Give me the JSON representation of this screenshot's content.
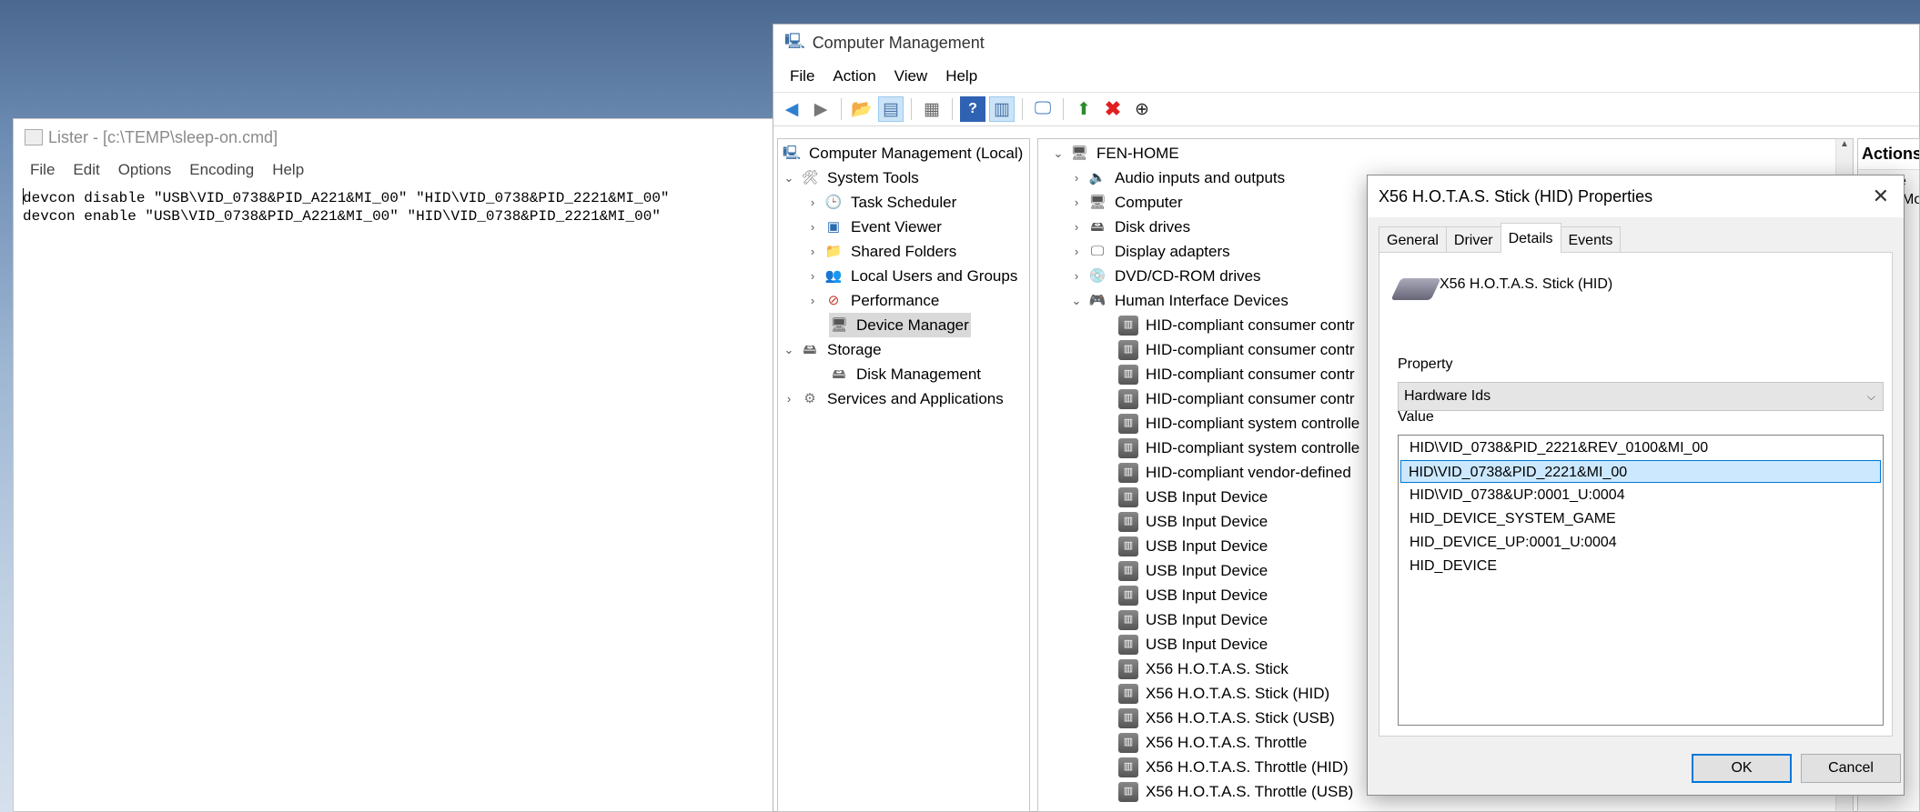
{
  "lister": {
    "title": "Lister - [c:\\TEMP\\sleep-on.cmd]",
    "menu": [
      "File",
      "Edit",
      "Options",
      "Encoding",
      "Help"
    ],
    "lines": [
      "devcon disable \"USB\\VID_0738&PID_A221&MI_00\" \"HID\\VID_0738&PID_2221&MI_00\"",
      "devcon enable \"USB\\VID_0738&PID_A221&MI_00\" \"HID\\VID_0738&PID_2221&MI_00\""
    ]
  },
  "cm": {
    "title": "Computer Management",
    "menu": [
      "File",
      "Action",
      "View",
      "Help"
    ],
    "tree": {
      "root": "Computer Management (Local)",
      "system_tools": "System Tools",
      "task_scheduler": "Task Scheduler",
      "event_viewer": "Event Viewer",
      "shared_folders": "Shared Folders",
      "local_users": "Local Users and Groups",
      "performance": "Performance",
      "device_manager": "Device Manager",
      "storage": "Storage",
      "disk_management": "Disk Management",
      "services": "Services and Applications"
    },
    "devices": {
      "host": "FEN-HOME",
      "categories": [
        "Audio inputs and outputs",
        "Computer",
        "Disk drives",
        "Display adapters",
        "DVD/CD-ROM drives",
        "Human Interface Devices"
      ],
      "hid_children": [
        "HID-compliant consumer contr",
        "HID-compliant consumer contr",
        "HID-compliant consumer contr",
        "HID-compliant consumer contr",
        "HID-compliant system controlle",
        "HID-compliant system controlle",
        "HID-compliant vendor-defined",
        "USB Input Device",
        "USB Input Device",
        "USB Input Device",
        "USB Input Device",
        "USB Input Device",
        "USB Input Device",
        "USB Input Device",
        "X56 H.O.T.A.S. Stick",
        "X56 H.O.T.A.S. Stick (HID)",
        "X56 H.O.T.A.S. Stick (USB)",
        "X56 H.O.T.A.S. Throttle",
        "X56 H.O.T.A.S. Throttle (HID)",
        "X56 H.O.T.A.S. Throttle (USB)"
      ]
    },
    "actions": {
      "title": "Actions",
      "item1": "e",
      "item2": "Mo"
    }
  },
  "dialog": {
    "title": "X56 H.O.T.A.S. Stick (HID) Properties",
    "tabs": [
      "General",
      "Driver",
      "Details",
      "Events"
    ],
    "device_name": "X56 H.O.T.A.S. Stick (HID)",
    "property_label": "Property",
    "property_value": "Hardware Ids",
    "value_label": "Value",
    "values": [
      "HID\\VID_0738&PID_2221&REV_0100&MI_00",
      "HID\\VID_0738&PID_2221&MI_00",
      "HID\\VID_0738&UP:0001_U:0004",
      "HID_DEVICE_SYSTEM_GAME",
      "HID_DEVICE_UP:0001_U:0004",
      "HID_DEVICE"
    ],
    "ok": "OK",
    "cancel": "Cancel"
  }
}
